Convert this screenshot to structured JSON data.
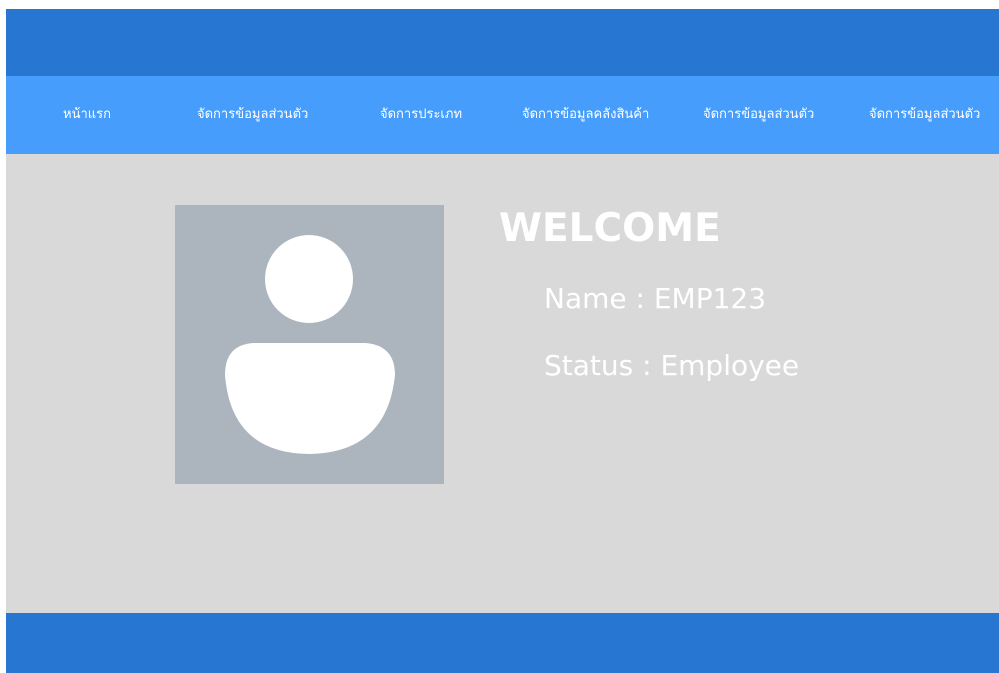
{
  "nav": {
    "items": [
      {
        "label": "หน้าแรก"
      },
      {
        "label": "จัดการข้อมูลส่วนตัว"
      },
      {
        "label": "จัดการประเภท"
      },
      {
        "label": "จัดการข้อมูลคลังสินค้า"
      },
      {
        "label": "จัดการข้อมูลส่วนตัว"
      },
      {
        "label": "จัดการข้อมูลส่วนตัว"
      }
    ]
  },
  "profile": {
    "avatar_icon": "user-silhouette-icon",
    "welcome": "WELCOME",
    "name_line": "Name : EMP123",
    "status_line": "Status : Employee"
  },
  "colors": {
    "header": "#2776d2",
    "nav": "#479dfb",
    "content_bg": "#d9d9d9",
    "avatar_bg": "#acb4bd",
    "text": "#ffffff"
  }
}
